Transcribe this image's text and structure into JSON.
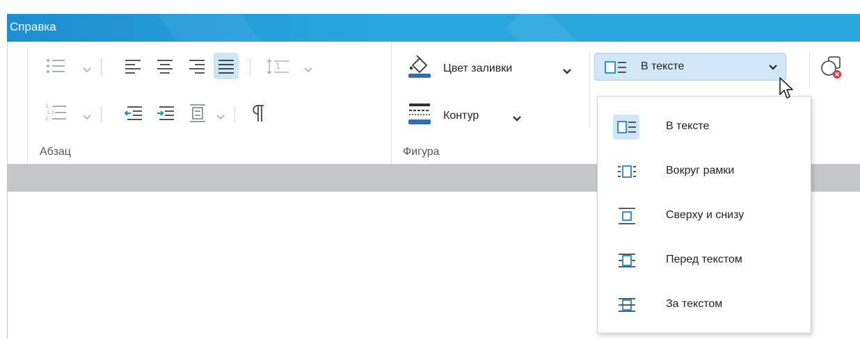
{
  "titlebar": {
    "title": "Справка"
  },
  "ribbon": {
    "paragraph_group": {
      "label": "Абзац"
    },
    "shape_group": {
      "label": "Фигура",
      "fill_color_label": "Цвет заливки",
      "outline_label": "Контур"
    },
    "wrap_button": {
      "label": "В тексте"
    }
  },
  "wrap_menu": {
    "items": [
      {
        "label": "В тексте",
        "icon": "wrap-inline-icon",
        "selected": true
      },
      {
        "label": "Вокруг рамки",
        "icon": "wrap-square-icon",
        "selected": false
      },
      {
        "label": "Сверху и снизу",
        "icon": "wrap-top-bottom-icon",
        "selected": false
      },
      {
        "label": "Перед текстом",
        "icon": "wrap-in-front-icon",
        "selected": false
      },
      {
        "label": "За текстом",
        "icon": "wrap-behind-icon",
        "selected": false
      }
    ]
  },
  "colors": {
    "accent": "#2aa7de",
    "selection": "#cfe6f7",
    "icon_blue": "#1e88c8",
    "icon_gray": "#9aa0a6"
  }
}
